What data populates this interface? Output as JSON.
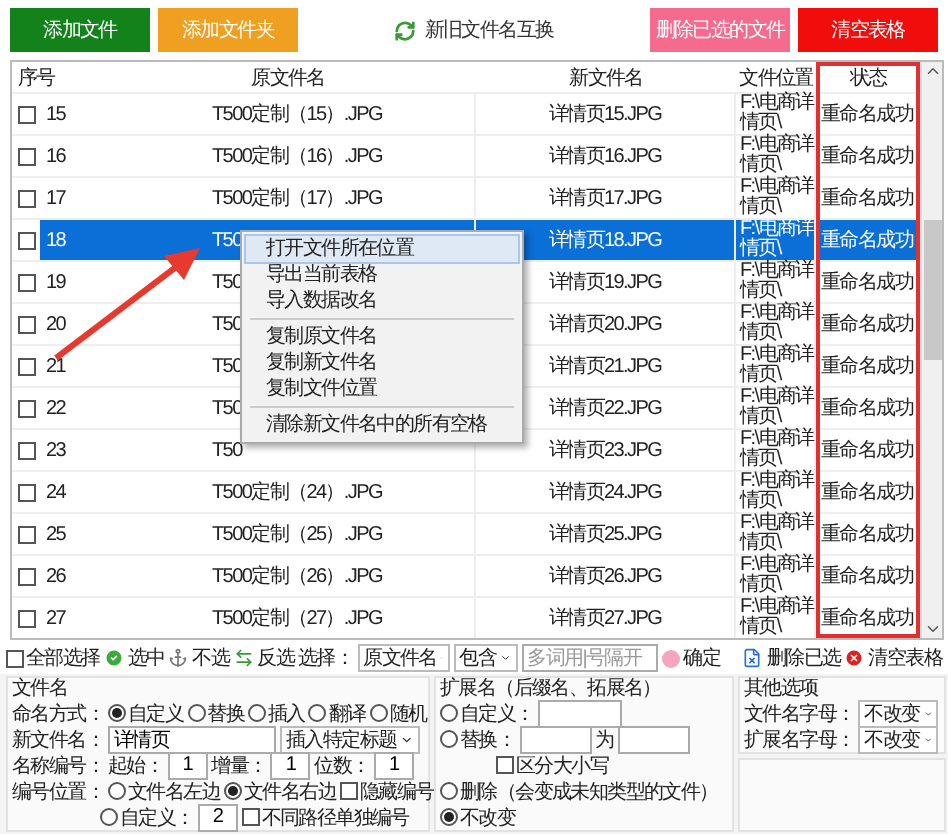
{
  "toolbar": {
    "buttons": [
      {
        "label": "添加文件",
        "kind": "filled",
        "color": "#13821b"
      },
      {
        "label": "添加文件夹",
        "kind": "filled",
        "color": "#f0a020"
      },
      {
        "label": "新旧文件名互换",
        "kind": "swap"
      },
      {
        "label": "删除已选的文件",
        "kind": "filled",
        "color": "#f46b8e"
      },
      {
        "label": "清空表格",
        "kind": "filled",
        "color": "#f20d0d"
      }
    ]
  },
  "table": {
    "columns": [
      "序号",
      "原文件名",
      "新文件名",
      "文件位置",
      "状态"
    ],
    "rows": [
      {
        "no": "15",
        "original": "T500定制（15）.JPG",
        "new": "详情页15.JPG",
        "location": "F:\\电商详情页\\",
        "status": "重命名成功",
        "checked": false,
        "selected": false
      },
      {
        "no": "16",
        "original": "T500定制（16）.JPG",
        "new": "详情页16.JPG",
        "location": "F:\\电商详情页\\",
        "status": "重命名成功",
        "checked": false,
        "selected": false
      },
      {
        "no": "17",
        "original": "T500定制（17）.JPG",
        "new": "详情页17.JPG",
        "location": "F:\\电商详情页\\",
        "status": "重命名成功",
        "checked": false,
        "selected": false
      },
      {
        "no": "18",
        "original": "T50",
        "new": "详情页18.JPG",
        "location": "F:\\电商详情页\\",
        "status": "重命名成功",
        "checked": false,
        "selected": true
      },
      {
        "no": "19",
        "original": "T50",
        "new": "详情页19.JPG",
        "location": "F:\\电商详情页\\",
        "status": "重命名成功",
        "checked": false,
        "selected": false
      },
      {
        "no": "20",
        "original": "T50",
        "new": "详情页20.JPG",
        "location": "F:\\电商详情页\\",
        "status": "重命名成功",
        "checked": false,
        "selected": false
      },
      {
        "no": "21",
        "original": "T50",
        "new": "详情页21.JPG",
        "location": "F:\\电商详情页\\",
        "status": "重命名成功",
        "checked": false,
        "selected": false
      },
      {
        "no": "22",
        "original": "T50",
        "new": "详情页22.JPG",
        "location": "F:\\电商详情页\\",
        "status": "重命名成功",
        "checked": false,
        "selected": false
      },
      {
        "no": "23",
        "original": "T50",
        "new": "详情页23.JPG",
        "location": "F:\\电商详情页\\",
        "status": "重命名成功",
        "checked": false,
        "selected": false
      },
      {
        "no": "24",
        "original": "T500定制（24）.JPG",
        "new": "详情页24.JPG",
        "location": "F:\\电商详情页\\",
        "status": "重命名成功",
        "checked": false,
        "selected": false
      },
      {
        "no": "25",
        "original": "T500定制（25）.JPG",
        "new": "详情页25.JPG",
        "location": "F:\\电商详情页\\",
        "status": "重命名成功",
        "checked": false,
        "selected": false
      },
      {
        "no": "26",
        "original": "T500定制（26）.JPG",
        "new": "详情页26.JPG",
        "location": "F:\\电商详情页\\",
        "status": "重命名成功",
        "checked": false,
        "selected": false
      },
      {
        "no": "27",
        "original": "T500定制（27）.JPG",
        "new": "详情页27.JPG",
        "location": "F:\\电商详情页\\",
        "status": "重命名成功",
        "checked": false,
        "selected": false
      }
    ]
  },
  "context_menu": {
    "groups": [
      [
        {
          "label": "打开文件所在位置",
          "selected": true
        },
        {
          "label": "导出当前表格",
          "selected": false
        },
        {
          "label": "导入数据改名",
          "selected": false
        }
      ],
      [
        {
          "label": "复制原文件名",
          "selected": false
        },
        {
          "label": "复制新文件名",
          "selected": false
        },
        {
          "label": "复制文件位置",
          "selected": false
        }
      ],
      [
        {
          "label": "清除新文件名中的所有空格",
          "selected": false
        }
      ]
    ]
  },
  "selection_bar": {
    "select_all": {
      "label": "全部选择",
      "checked": false
    },
    "actions": [
      {
        "label": "选中",
        "kind": "check"
      },
      {
        "label": "不选",
        "kind": "anchor"
      },
      {
        "label": "反选",
        "kind": "invert"
      }
    ],
    "select_label": "选择：",
    "field_dropdown": "原文件名",
    "match_dropdown": "包含",
    "keyword_placeholder": "多词用|号隔开",
    "confirm": "确定",
    "tools": [
      {
        "label": "删除已选",
        "kind": "delete"
      },
      {
        "label": "清空表格",
        "kind": "clear"
      }
    ]
  },
  "filename_panel": {
    "title": "文件名",
    "naming_label": "命名方式：",
    "naming_options": [
      {
        "label": "自定义",
        "selected": true
      },
      {
        "label": "替换",
        "selected": false
      },
      {
        "label": "插入",
        "selected": false
      },
      {
        "label": "翻译",
        "selected": false
      },
      {
        "label": "随机",
        "selected": false
      }
    ],
    "new_name_label": "新文件名：",
    "new_name_value": "详情页",
    "insert_dropdown": "插入特定标题",
    "numbering_label": "名称编号：",
    "numbering_fields": [
      {
        "label": "起始：",
        "value": "1"
      },
      {
        "label": "增量：",
        "value": "1"
      },
      {
        "label": "位数：",
        "value": "1"
      }
    ],
    "position_label": "编号位置：",
    "position_options": [
      {
        "label": "文件名左边",
        "selected": false
      },
      {
        "label": "文件名右边",
        "selected": true
      },
      {
        "label": "自定义：",
        "selected": false
      }
    ],
    "custom_value": "2",
    "hide_number": {
      "label": "隐藏编号",
      "checked": false
    },
    "separate_numbering": {
      "label": "不同路径单独编号",
      "checked": false
    }
  },
  "extension_panel": {
    "title": "扩展名（后缀名、拓展名）",
    "options": [
      {
        "kind": "custom",
        "label": "自定义：",
        "selected": false
      },
      {
        "kind": "replace",
        "label": "替换：",
        "joiner": "为",
        "selected": false
      },
      {
        "kind": "delete",
        "label": "删除（会变成未知类型的文件）",
        "selected": false
      },
      {
        "kind": "keep",
        "label": "不改变",
        "selected": true
      }
    ],
    "case_sensitive": {
      "label": "区分大小写",
      "checked": false
    }
  },
  "other_panel": {
    "title": "其他选项",
    "fields": [
      {
        "label": "文件名字母：",
        "value": "不改变"
      },
      {
        "label": "扩展名字母：",
        "value": "不改变"
      }
    ]
  }
}
